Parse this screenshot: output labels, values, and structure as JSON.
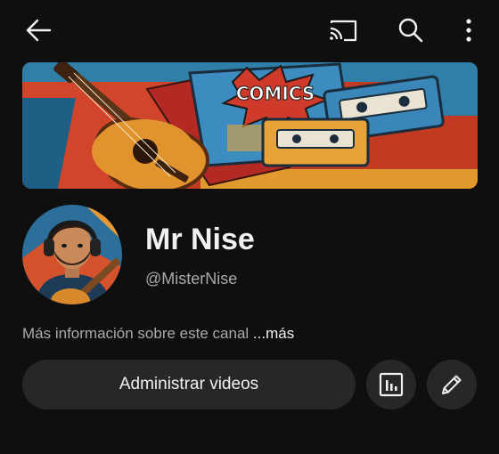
{
  "topbar": {
    "back_icon": "arrow-back-icon",
    "cast_icon": "cast-icon",
    "search_icon": "search-icon",
    "more_icon": "more-vert-icon"
  },
  "banner": {
    "comic_title": "COMICS"
  },
  "channel": {
    "name": "Mr Nise",
    "handle": "@MisterNise",
    "about_text": "Más información sobre este canal",
    "about_more": "...más"
  },
  "actions": {
    "manage_label": "Administrar videos",
    "stats_icon": "analytics-icon",
    "edit_icon": "pencil-icon"
  },
  "colors": {
    "background": "#0f0f0f",
    "button_bg": "#272727",
    "secondary_text": "#aaaaaa",
    "primary_text": "#f1f1f1"
  }
}
